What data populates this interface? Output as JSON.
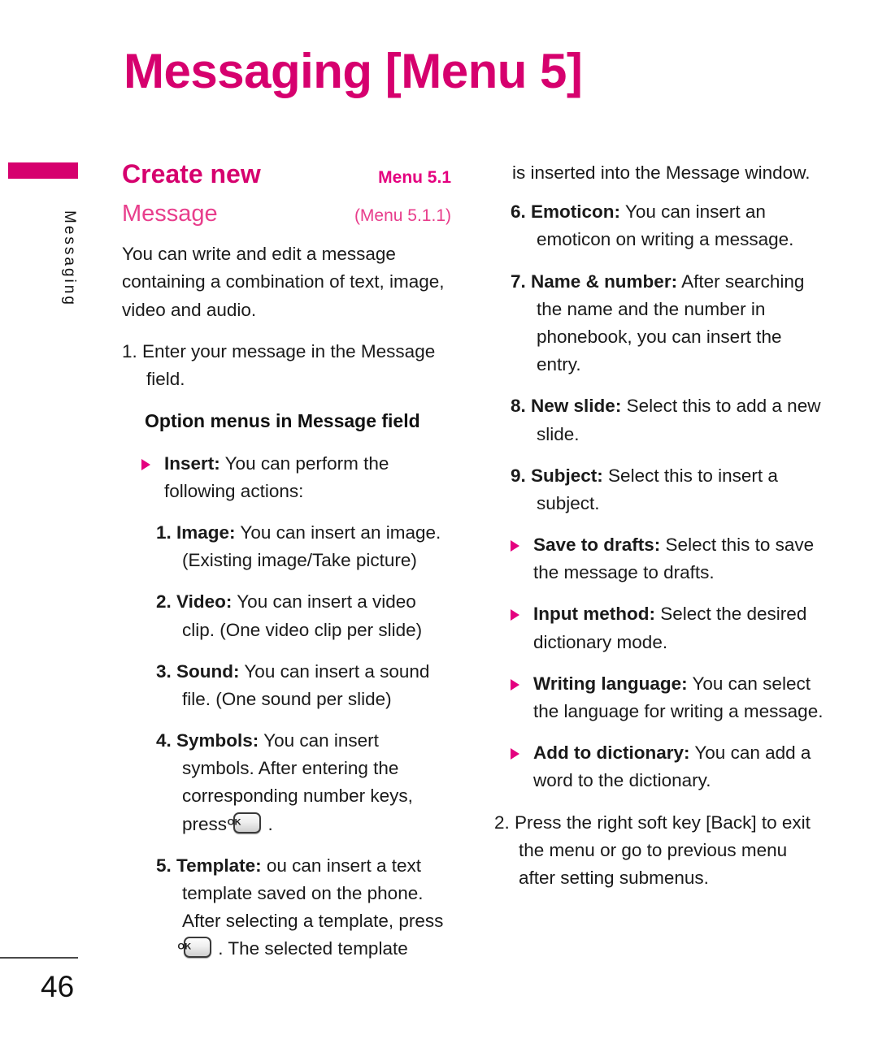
{
  "page": {
    "title": "Messaging [Menu 5]",
    "number": "46",
    "side_tab_label": "Messaging",
    "accent_color": "#D6006E",
    "sub_accent_color": "#E83E8C",
    "bullet_icon": "triangle-right-icon",
    "ok_key_icon": "ok-key-icon",
    "ok_key_label": "OK"
  },
  "left_column": {
    "section": {
      "title": "Create new",
      "ref": "Menu  5.1"
    },
    "subsection": {
      "title": "Message",
      "ref": "(Menu 5.1.1)"
    },
    "intro": "You can write and edit a message containing a combination of text, image, video and audio.",
    "step_1": {
      "num": "1.",
      "text": "Enter your message in the Message field."
    },
    "option_heading": "Option menus in Message field",
    "insert_bullet": {
      "label": "Insert:",
      "text": " You can perform the following actions:"
    },
    "insert_items": [
      {
        "num": "1.",
        "label": "Image:",
        "text": " You can insert an image. (Existing image/Take picture)"
      },
      {
        "num": "2.",
        "label": "Video:",
        "text": " You can insert a video clip. (One video clip per slide)"
      },
      {
        "num": "3.",
        "label": "Sound:",
        "text": " You can insert a sound file. (One sound per slide)"
      },
      {
        "num": "4.",
        "label": "Symbols:",
        "text_before": " You can insert symbols. After entering the corresponding number keys, press ",
        "text_after": " ."
      },
      {
        "num": "5.",
        "label": "Template:",
        "text_before": " ou can insert a text template saved on the phone. After selecting a template, press ",
        "text_after": " . The selected template"
      }
    ]
  },
  "right_column": {
    "continued_text": "is inserted into the Message window.",
    "insert_items": [
      {
        "num": "6.",
        "label": "Emoticon:",
        "text": " You can insert an emoticon on writing a message."
      },
      {
        "num": "7.",
        "label": "Name & number:",
        "text": " After searching the name and the number in phonebook, you can insert the entry."
      },
      {
        "num": "8.",
        "label": "New slide:",
        "text": " Select this to add a new slide."
      },
      {
        "num": "9.",
        "label": "Subject:",
        "text": " Select this to insert a subject."
      }
    ],
    "bullets": [
      {
        "label": "Save to drafts:",
        "text": " Select this to save the message to drafts."
      },
      {
        "label": "Input method:",
        "text": " Select the desired dictionary mode."
      },
      {
        "label": "Writing language:",
        "text": " You can select the language for writing a message."
      },
      {
        "label": "Add to dictionary:",
        "text": " You can add a word to the dictionary."
      }
    ],
    "step_2": {
      "num": "2.",
      "text": "Press the right soft key [Back] to exit the menu or go to previous menu after setting submenus."
    }
  }
}
